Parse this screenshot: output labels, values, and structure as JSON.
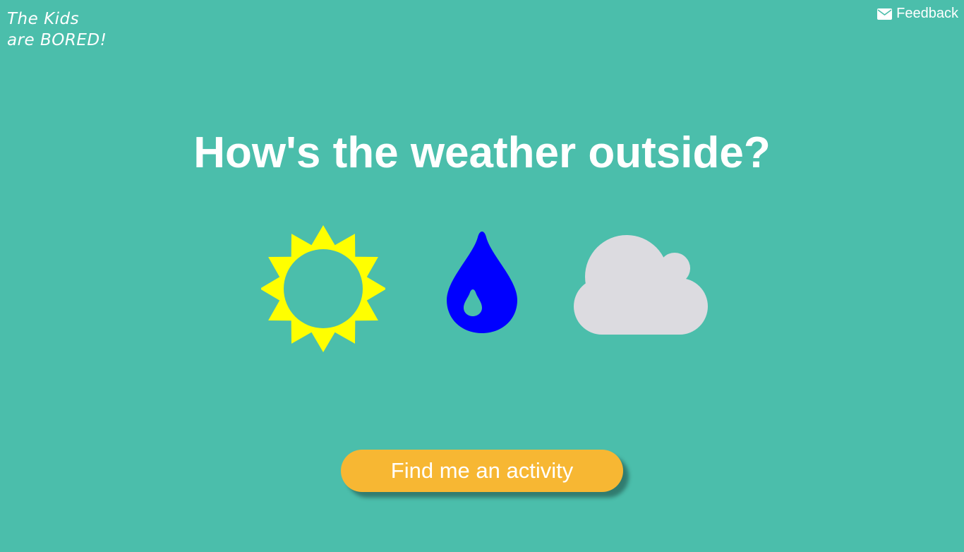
{
  "logo": {
    "line1": "The Kids",
    "line2": "are BORED!"
  },
  "header": {
    "feedback_label": "Feedback",
    "feedback_icon": "envelope-icon"
  },
  "main": {
    "question": "How's the weather outside?",
    "options": [
      {
        "icon": "sun-icon",
        "color": "#ffff00"
      },
      {
        "icon": "raindrop-icon",
        "color": "#0000ff"
      },
      {
        "icon": "cloud-icon",
        "color": "#dcdbe0"
      }
    ],
    "cta_label": "Find me an activity"
  },
  "colors": {
    "background": "#4bbeab",
    "accent": "#f7b733",
    "text": "#ffffff"
  }
}
